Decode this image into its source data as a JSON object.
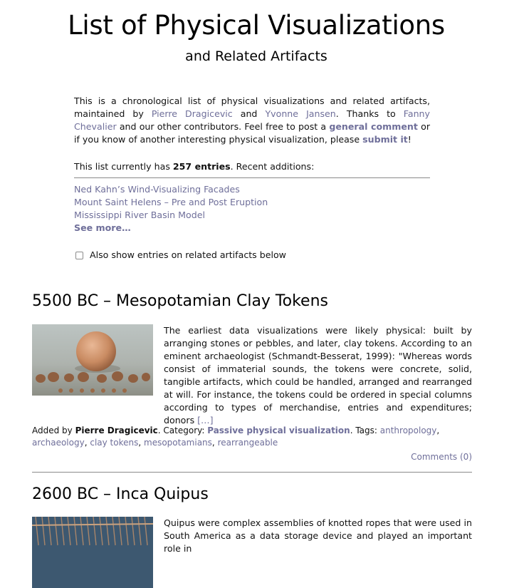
{
  "header": {
    "title": "List of Physical Visualizations",
    "subtitle": "and Related Artifacts"
  },
  "intro": {
    "t1": "This is a chronological list of physical visualizations and related artifacts, maintained by ",
    "author1": "Pierre Dragicevic",
    "t2": " and ",
    "author2": "Yvonne Jansen",
    "t3": ". Thanks to ",
    "thanks": "Fanny Chevalier",
    "t4": " and our other contributors. Feel free to post a ",
    "comment_link": "general comment",
    "t5": " or if you know of another interesting physical visualization, please ",
    "submit_link": "submit it",
    "t6": "!"
  },
  "count": {
    "prefix": "This list currently has ",
    "entries": "257 entries",
    "suffix": ". Recent additions:"
  },
  "recent": {
    "items": [
      "Ned Kahn’s Wind-Visualizing Facades",
      "Mount Saint Helens – Pre and Post Eruption",
      "Mississippi River Basin Model"
    ],
    "see_more": "See more…"
  },
  "filter": {
    "checkbox_label": "Also show entries on related artifacts below"
  },
  "entries": [
    {
      "title": "5500 BC – Mesopotamian Clay Tokens",
      "text": "The earliest data visualizations were likely physical: built by arranging stones or pebbles, and later, clay tokens. According to an eminent archaeologist (Schmandt-Besserat, 1999): \"Whereas words consist of immaterial sounds, the tokens were concrete, solid, tangible artifacts, which could be handled, arranged and rearranged at will. For instance, the tokens could be ordered in special columns according to types of merchandise, entries and expenditures; donors",
      "more": "[…]",
      "added_by_prefix": "Added by ",
      "added_by": "Pierre Dragicevic",
      "category_prefix": ". Category: ",
      "category": "Passive physical visualization",
      "tags_prefix": ". Tags: ",
      "tags": [
        "anthropology",
        "archaeology",
        "clay tokens",
        "mesopotamians",
        "rearrangeable"
      ],
      "comments": "Comments (0)"
    },
    {
      "title": "2600 BC – Inca Quipus",
      "text": "Quipus were complex assemblies of knotted ropes that were used in South America as a data storage device and played an important role in"
    }
  ]
}
